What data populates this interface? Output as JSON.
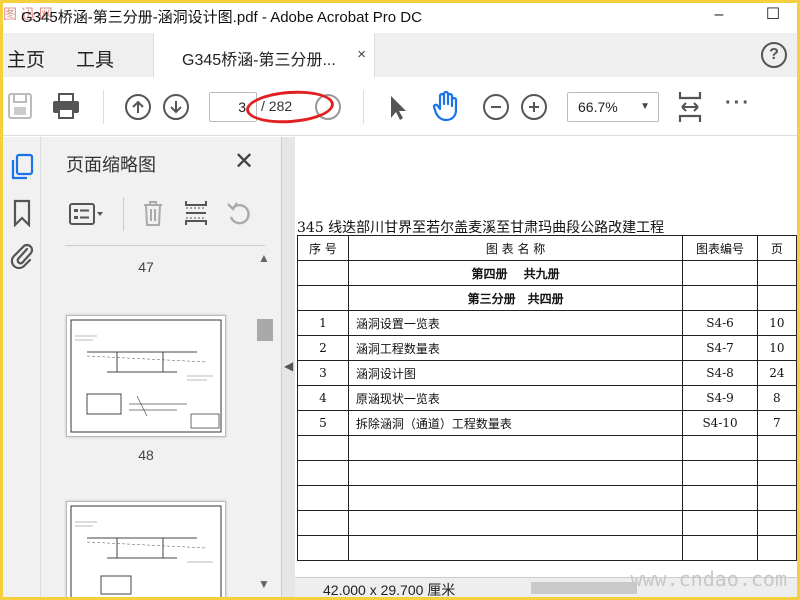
{
  "window": {
    "title": "G345桥涵-第三分册-涵洞设计图.pdf - Adobe Acrobat Pro DC",
    "watermark_top": "图 迅 网",
    "minimize": "–",
    "maximize": "☐"
  },
  "tabs": {
    "home": "主页",
    "tools": "工具",
    "doc": "G345桥涵-第三分册...",
    "doc_close": "×",
    "help": "?"
  },
  "toolbar": {
    "page_current": "3",
    "page_total": "/ 282",
    "zoom": "66.7%",
    "more": "···"
  },
  "thumbnails": {
    "header": "页面缩略图",
    "close": "✕",
    "pages": [
      "47",
      "48"
    ]
  },
  "document": {
    "title": "345 线迭部川甘界至若尔盖麦溪至甘肃玛曲段公路改建工程",
    "headers": [
      "序 号",
      "图 表 名 称",
      "图表编号",
      "页"
    ],
    "volume_rows": [
      "第四册　 共九册",
      "第三分册　共四册"
    ],
    "rows": [
      {
        "no": "1",
        "name": "涵洞设置一览表",
        "code": "S4-6",
        "page": "10"
      },
      {
        "no": "2",
        "name": "涵洞工程数量表",
        "code": "S4-7",
        "page": "10"
      },
      {
        "no": "3",
        "name": "涵洞设计图",
        "code": "S4-8",
        "page": "24"
      },
      {
        "no": "4",
        "name": "原涵现状一览表",
        "code": "S4-9",
        "page": "8"
      },
      {
        "no": "5",
        "name": "拆除涵洞（通道）工程数量表",
        "code": "S4-10",
        "page": "7"
      }
    ]
  },
  "status": {
    "dimensions": "42.000 x 29.700 厘米",
    "watermark": "www.cndao.com"
  },
  "colors": {
    "frame": "#f4d03f",
    "annotation": "#e02020",
    "accent_hand": "#1a73e8"
  }
}
